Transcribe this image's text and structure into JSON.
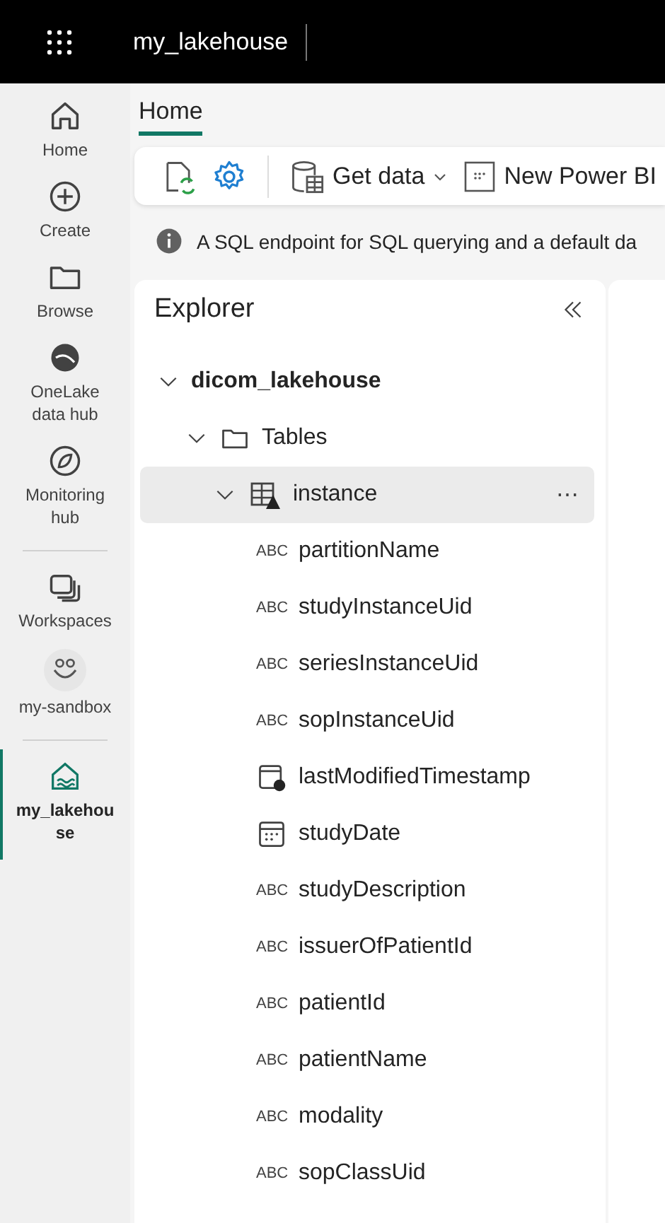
{
  "topbar": {
    "title": "my_lakehouse"
  },
  "nav": [
    {
      "label": "Home",
      "selected": false
    },
    {
      "label": "Create",
      "selected": false
    },
    {
      "label": "Browse",
      "selected": false
    },
    {
      "label": "OneLake data hub",
      "selected": false
    },
    {
      "label": "Monitoring hub",
      "selected": false
    },
    {
      "kind": "divider"
    },
    {
      "label": "Workspaces",
      "selected": false
    },
    {
      "label": "my-sandbox",
      "selected": false
    },
    {
      "kind": "divider"
    },
    {
      "label": "my_lakehouse",
      "selected": true
    }
  ],
  "tabs": [
    {
      "label": "Home",
      "selected": true
    }
  ],
  "toolbar": [
    {
      "kind": "refresh"
    },
    {
      "kind": "settings"
    },
    {
      "kind": "separator"
    },
    {
      "kind": "getdata",
      "label": "Get data"
    },
    {
      "kind": "powerbi",
      "label": "New Power BI"
    }
  ],
  "info": {
    "text": "A SQL endpoint for SQL querying and a default da"
  },
  "explorer": {
    "title": "Explorer",
    "tree": [
      {
        "label": "dicom_lakehouse",
        "kind": "lakehouse",
        "expanded": true,
        "selected": false,
        "children": [
          {
            "label": "Tables",
            "kind": "folder",
            "expanded": true,
            "selected": false,
            "children": [
              {
                "label": "instance",
                "kind": "table",
                "expanded": true,
                "selected": true,
                "more": "⋯",
                "children": [
                  {
                    "label": "partitionName",
                    "kind": "string",
                    "type_badge": "ABC"
                  },
                  {
                    "label": "studyInstanceUid",
                    "kind": "string",
                    "type_badge": "ABC"
                  },
                  {
                    "label": "seriesInstanceUid",
                    "kind": "string",
                    "type_badge": "ABC"
                  },
                  {
                    "label": "sopInstanceUid",
                    "kind": "string",
                    "type_badge": "ABC"
                  },
                  {
                    "label": "lastModifiedTimestamp",
                    "kind": "timestamp"
                  },
                  {
                    "label": "studyDate",
                    "kind": "date"
                  },
                  {
                    "label": "studyDescription",
                    "kind": "string",
                    "type_badge": "ABC"
                  },
                  {
                    "label": "issuerOfPatientId",
                    "kind": "string",
                    "type_badge": "ABC"
                  },
                  {
                    "label": "patientId",
                    "kind": "string",
                    "type_badge": "ABC"
                  },
                  {
                    "label": "patientName",
                    "kind": "string",
                    "type_badge": "ABC"
                  },
                  {
                    "label": "modality",
                    "kind": "string",
                    "type_badge": "ABC"
                  },
                  {
                    "label": "sopClassUid",
                    "kind": "string",
                    "type_badge": "ABC"
                  }
                ]
              }
            ]
          }
        ]
      }
    ]
  }
}
